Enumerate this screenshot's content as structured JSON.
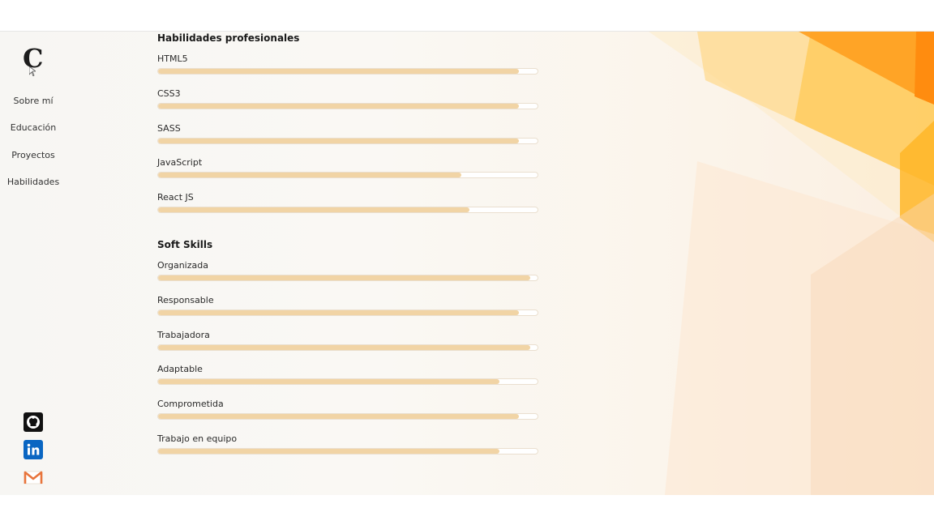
{
  "sidebar": {
    "logo_letter": "C",
    "nav": [
      {
        "label": "Sobre mí"
      },
      {
        "label": "Educación"
      },
      {
        "label": "Proyectos"
      },
      {
        "label": "Habilidades"
      }
    ],
    "social": [
      {
        "icon": "github-icon"
      },
      {
        "icon": "linkedin-icon"
      },
      {
        "icon": "gmail-icon"
      }
    ]
  },
  "professional": {
    "title": "Habilidades profesionales",
    "skills": [
      {
        "label": "HTML5",
        "level": 0.95
      },
      {
        "label": "CSS3",
        "level": 0.95
      },
      {
        "label": "SASS",
        "level": 0.95
      },
      {
        "label": "JavaScript",
        "level": 0.8
      },
      {
        "label": "React JS",
        "level": 0.82
      }
    ]
  },
  "soft": {
    "title": "Soft Skills",
    "skills": [
      {
        "label": "Organizada",
        "level": 0.98
      },
      {
        "label": "Responsable",
        "level": 0.95
      },
      {
        "label": "Trabajadora",
        "level": 0.98
      },
      {
        "label": "Adaptable",
        "level": 0.9
      },
      {
        "label": "Comprometida",
        "level": 0.95
      },
      {
        "label": "Trabajo en equipo",
        "level": 0.9
      }
    ]
  },
  "colors": {
    "bar_fill": "#f1d4a5",
    "accent_orange": "#ff9a1a",
    "accent_yellow": "#ffc233",
    "linkedin_blue": "#0a66c2",
    "gmail_orange": "#e8743b"
  }
}
